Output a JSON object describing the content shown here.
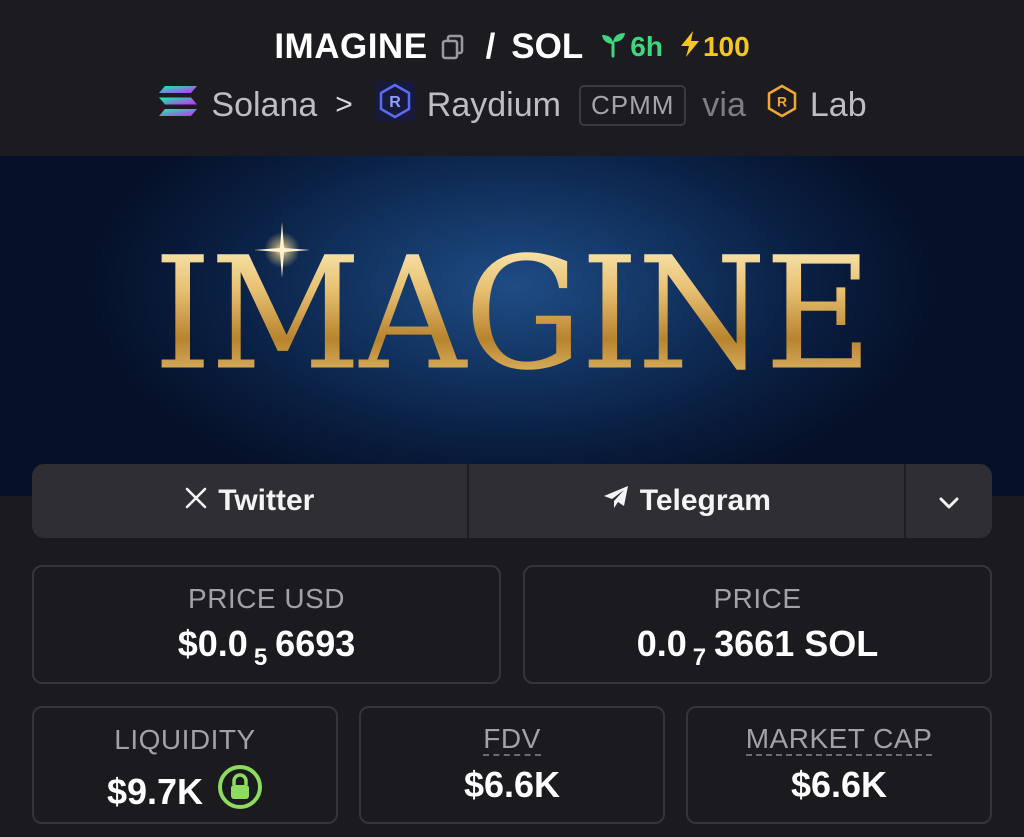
{
  "header": {
    "pair_base": "IMAGINE",
    "pair_slash": "/",
    "pair_quote": "SOL",
    "age": "6h",
    "boost": "100",
    "chain": "Solana",
    "chain_separator": ">",
    "dex": "Raydium",
    "pool_type": "CPMM",
    "via_label": "via",
    "launchpad": "Lab",
    "icons": [
      "copy-icon",
      "seedling-icon",
      "lightning-icon",
      "solana-icon",
      "raydium-icon",
      "lab-icon"
    ]
  },
  "banner": {
    "text": "IMAGINE"
  },
  "social": {
    "twitter_label": "Twitter",
    "telegram_label": "Telegram"
  },
  "stats": {
    "price_usd_label": "PRICE USD",
    "price_usd_prefix": "$0.0",
    "price_usd_zeros": "5",
    "price_usd_digits": "6693",
    "price_label": "PRICE",
    "price_prefix": "0.0",
    "price_zeros": "7",
    "price_digits": "3661 SOL",
    "liquidity_label": "LIQUIDITY",
    "liquidity_value": "$9.7K",
    "fdv_label": "FDV",
    "fdv_value": "$6.6K",
    "mcap_label": "MARKET CAP",
    "mcap_value": "$6.6K"
  },
  "colors": {
    "background": "#1b1b1f",
    "age_green": "#3fd67e",
    "boost_yellow": "#f3c623",
    "lock_green": "#8ddc5d",
    "banner_gold": "#d7a84c"
  }
}
